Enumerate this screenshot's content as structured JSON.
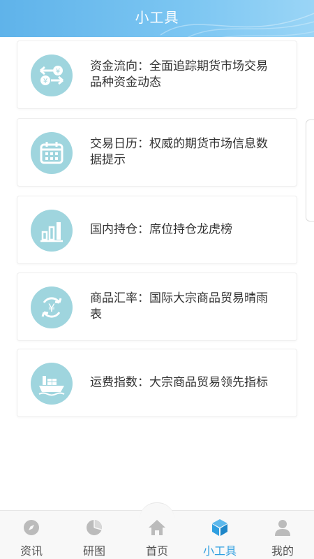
{
  "header": {
    "title": "小工具"
  },
  "tools": [
    {
      "icon": "currency-exchange-arrows-icon",
      "text": "资金流向：全面追踪期货市场交易品种资金动态"
    },
    {
      "icon": "calendar-icon",
      "text": "交易日历：权威的期货市场信息数据提示"
    },
    {
      "icon": "bar-chart-icon",
      "text": "国内持仓：席位持仓龙虎榜"
    },
    {
      "icon": "yen-cycle-icon",
      "text": "商品汇率：国际大宗商品贸易晴雨表"
    },
    {
      "icon": "cargo-ship-icon",
      "text": "运费指数：大宗商品贸易领先指标"
    }
  ],
  "tabbar": {
    "items": [
      {
        "label": "资讯",
        "icon": "compass-icon"
      },
      {
        "label": "研图",
        "icon": "pie-chart-icon"
      },
      {
        "label": "首页",
        "icon": "home-icon"
      },
      {
        "label": "小工具",
        "icon": "cube-icon",
        "active": true
      },
      {
        "label": "我的",
        "icon": "user-icon"
      }
    ]
  },
  "colors": {
    "header": "#6bbbee",
    "icon_circle": "#9fd5de",
    "tab_active": "#2f9fe0",
    "tab_inactive": "#bbbbbb"
  }
}
